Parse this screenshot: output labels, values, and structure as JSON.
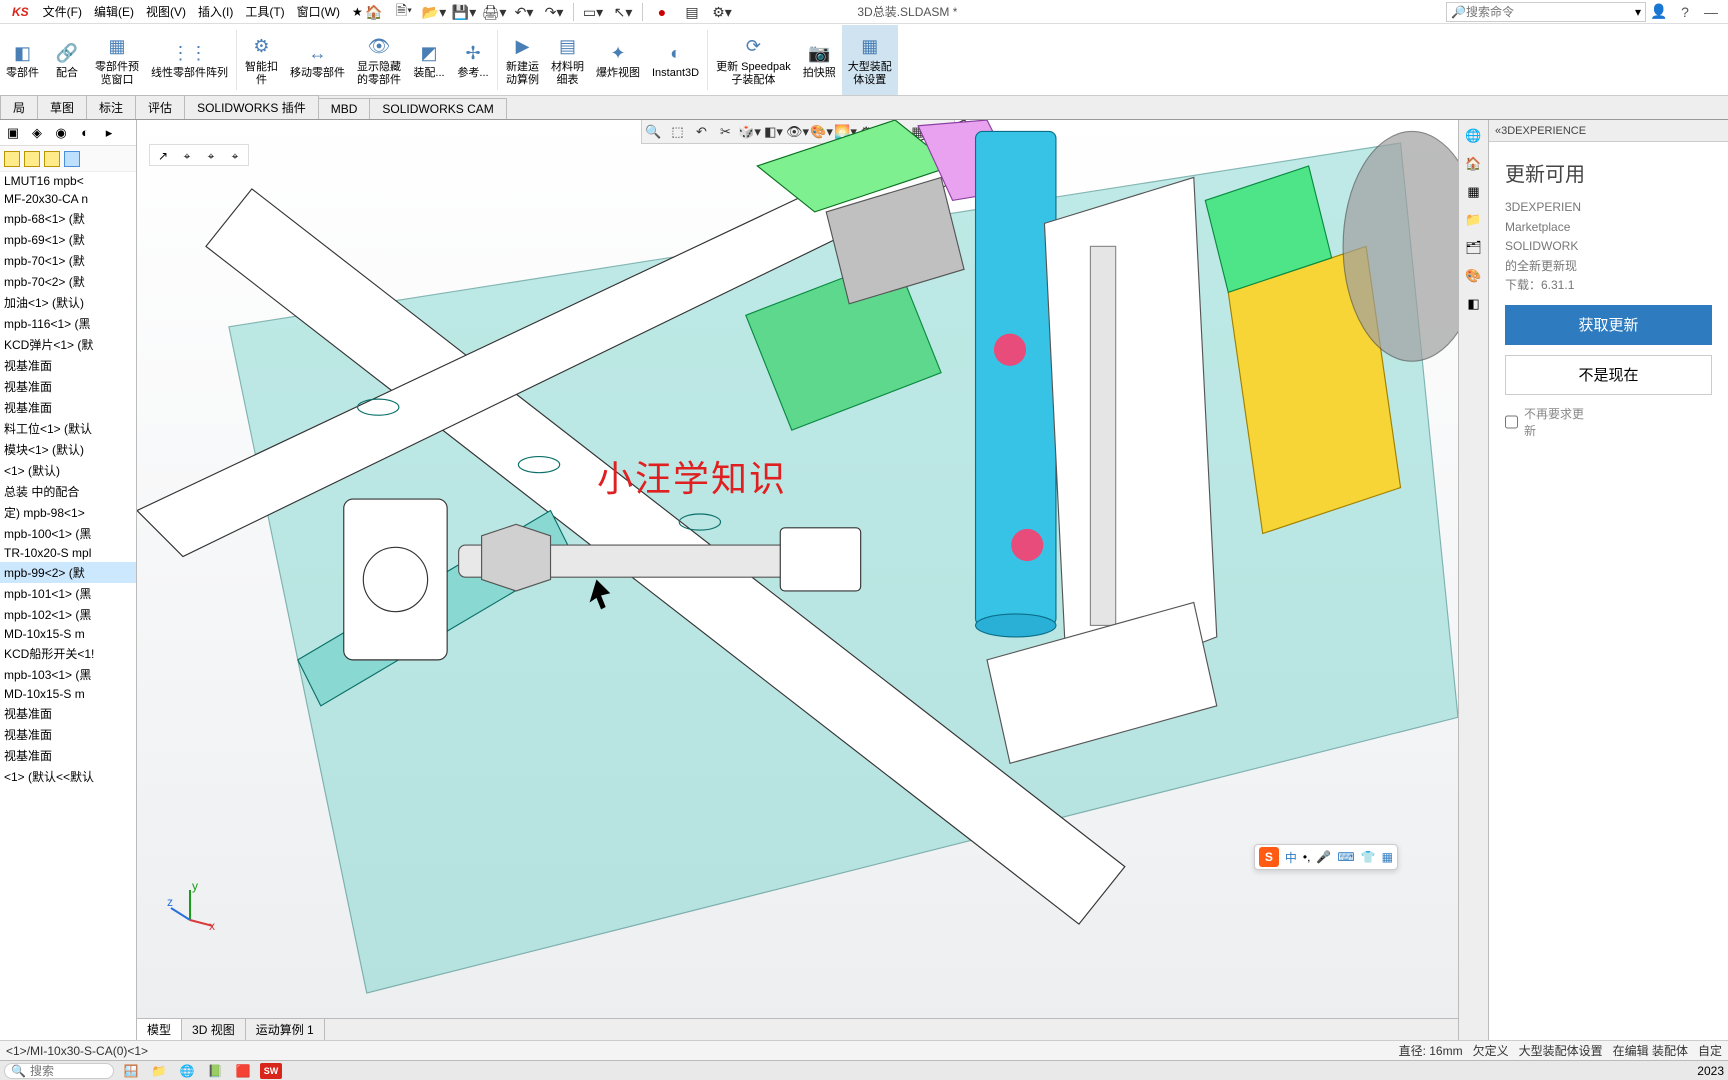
{
  "app": {
    "logo": "KS",
    "title": "3D总装.SLDASM *"
  },
  "menu": [
    "文件(F)",
    "编辑(E)",
    "视图(V)",
    "插入(I)",
    "工具(T)",
    "窗口(W)"
  ],
  "search_placeholder": "搜索命令",
  "ribbon": [
    {
      "label": "零部件",
      "icon": "◧"
    },
    {
      "label": "配合",
      "icon": "🔗"
    },
    {
      "label": "零部件预\n览窗口",
      "icon": "▦"
    },
    {
      "label": "线性零部件阵列",
      "icon": "⋮⋮⋮"
    },
    {
      "label": "智能扣\n件",
      "icon": "⚙"
    },
    {
      "label": "移动零部件",
      "icon": "↔"
    },
    {
      "label": "显示隐藏\n的零部件",
      "icon": "👁"
    },
    {
      "label": "装配...",
      "icon": "◩"
    },
    {
      "label": "参考...",
      "icon": "✢"
    },
    {
      "label": "新建运\n动算例",
      "icon": "▶"
    },
    {
      "label": "材料明\n细表",
      "icon": "▤"
    },
    {
      "label": "爆炸视图",
      "icon": "✦"
    },
    {
      "label": "Instant3D",
      "icon": "◐"
    },
    {
      "label": "更新 Speedpak\n子装配体",
      "icon": "⟳"
    },
    {
      "label": "拍快照",
      "icon": "📷"
    },
    {
      "label": "大型装配\n体设置",
      "icon": "▦",
      "active": true
    }
  ],
  "tabs": [
    "局",
    "草图",
    "标注",
    "评估",
    "SOLIDWORKS 插件",
    "MBD",
    "SOLIDWORKS CAM"
  ],
  "tree": [
    "LMUT16 mpb<",
    "MF-20x30-CA  n",
    "mpb-68<1> (默",
    "mpb-69<1> (默",
    "mpb-70<1> (默",
    "mpb-70<2> (默",
    "加油<1> (默认)",
    "mpb-116<1> (黑",
    "KCD弹片<1> (默",
    "视基准面",
    "视基准面",
    "视基准面",
    "料工位<1> (默认",
    "模块<1> (默认)",
    "<1> (默认)",
    "总装 中的配合",
    "定) mpb-98<1>",
    "mpb-100<1> (黑",
    "TR-10x20-S mpl",
    "mpb-99<2> (默",
    "mpb-101<1> (黑",
    "mpb-102<1> (黑",
    "MD-10x15-S  m",
    "KCD船形开关<1!",
    "mpb-103<1> (黑",
    "MD-10x15-S  m",
    "视基准面",
    "视基准面",
    "视基准面",
    "<1> (默认<<默认"
  ],
  "tree_selected_index": 19,
  "bottom_tabs": [
    "模型",
    "3D 视图",
    "运动算例 1"
  ],
  "status": {
    "path": "<1>/MI-10x30-S-CA(0)<1>",
    "diameter": "直径: 16mm",
    "underdef": "欠定义",
    "mode": "大型装配体设置",
    "edit": "在编辑 装配体",
    "custom": "自定"
  },
  "taskpane": {
    "header": "«3DEXPERIENCE",
    "title": "更新可用",
    "line1": "3DEXPERIEN",
    "line2": "Marketplace",
    "line3": "SOLIDWORK",
    "line4": "的全新更新现",
    "line5": "下载：6.31.1",
    "btn_primary": "获取更新",
    "btn_secondary": "不是现在",
    "check": "不再要求更\n新"
  },
  "watermark": "小汪学知识",
  "ime": {
    "label": "中"
  },
  "taskbar": {
    "search_label": "搜索",
    "date": "2023"
  },
  "triad": {
    "x": "x",
    "y": "y",
    "z": "z"
  }
}
